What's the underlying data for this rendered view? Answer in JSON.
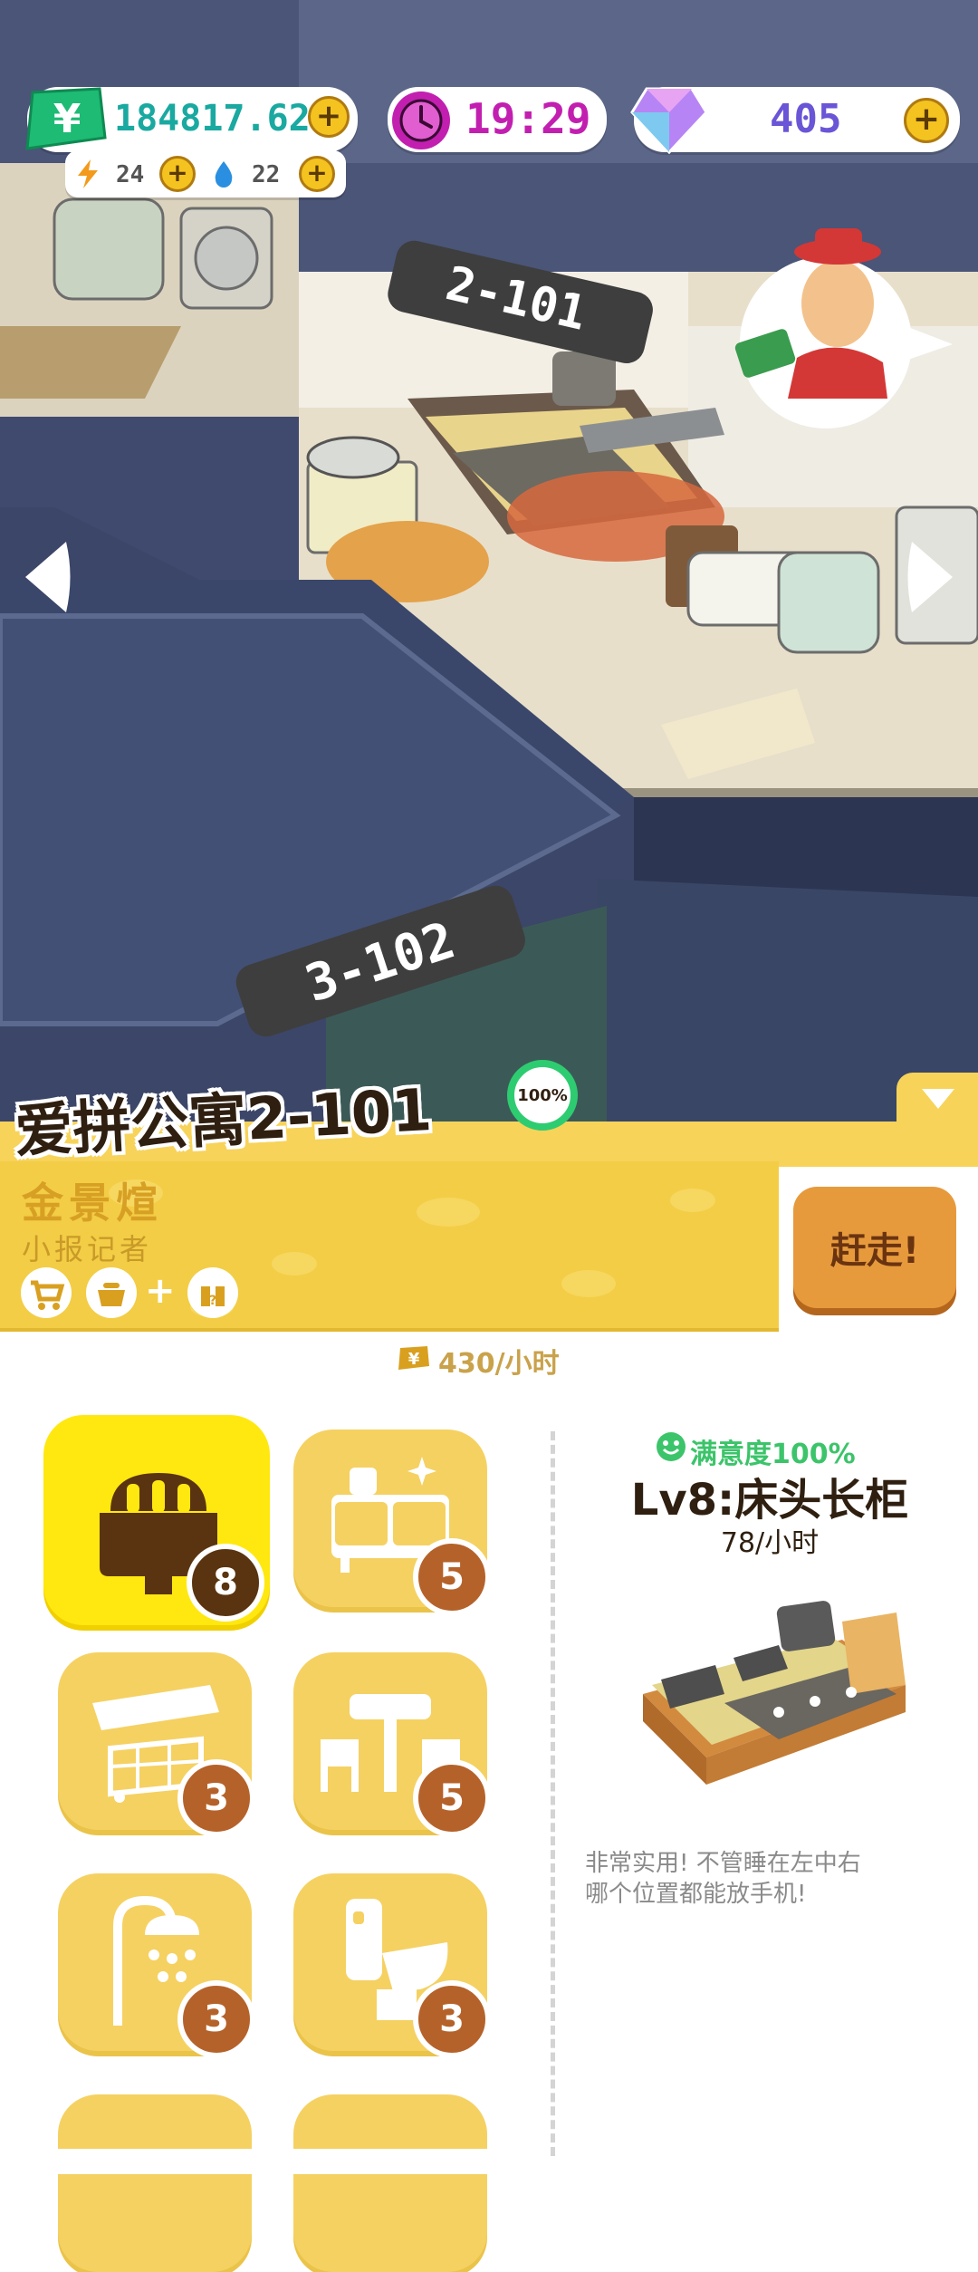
{
  "hud": {
    "money": "184817.62",
    "money_icon": "yen-icon",
    "energy": "24",
    "water": "22",
    "time": "19:29",
    "gems": "405"
  },
  "rooms": {
    "room_upper": "2-101",
    "room_lower": "3-102"
  },
  "apartment": {
    "title": "爱拼公寓2-101",
    "occupancy": "100%"
  },
  "tenant": {
    "name": "金景煊",
    "job": "小报记者",
    "evict_label": "赶走!",
    "traits": [
      "cart-icon",
      "pot-icon",
      "plus",
      "gift-icon"
    ]
  },
  "income": {
    "rate": "430/小时"
  },
  "furniture": [
    {
      "icon": "bed-icon",
      "level": "8",
      "selected": true
    },
    {
      "icon": "cabinet-icon",
      "level": "5"
    },
    {
      "icon": "shelf-cart-icon",
      "level": "3"
    },
    {
      "icon": "table-chairs-icon",
      "level": "5"
    },
    {
      "icon": "shower-icon",
      "level": "3"
    },
    {
      "icon": "toilet-icon",
      "level": "3"
    }
  ],
  "detail": {
    "satisfaction": "满意度100%",
    "item_name": "Lv8:床头长柜",
    "rate": "78/小时",
    "description_line1": "非常实用! 不管睡在左中右",
    "description_line2": "哪个位置都能放手机!"
  },
  "colors": {
    "panel_yellow": "#f3cd45",
    "accent_orange": "#e79a3c",
    "money_green": "#1dbb74",
    "time_purple": "#c21fb0"
  }
}
